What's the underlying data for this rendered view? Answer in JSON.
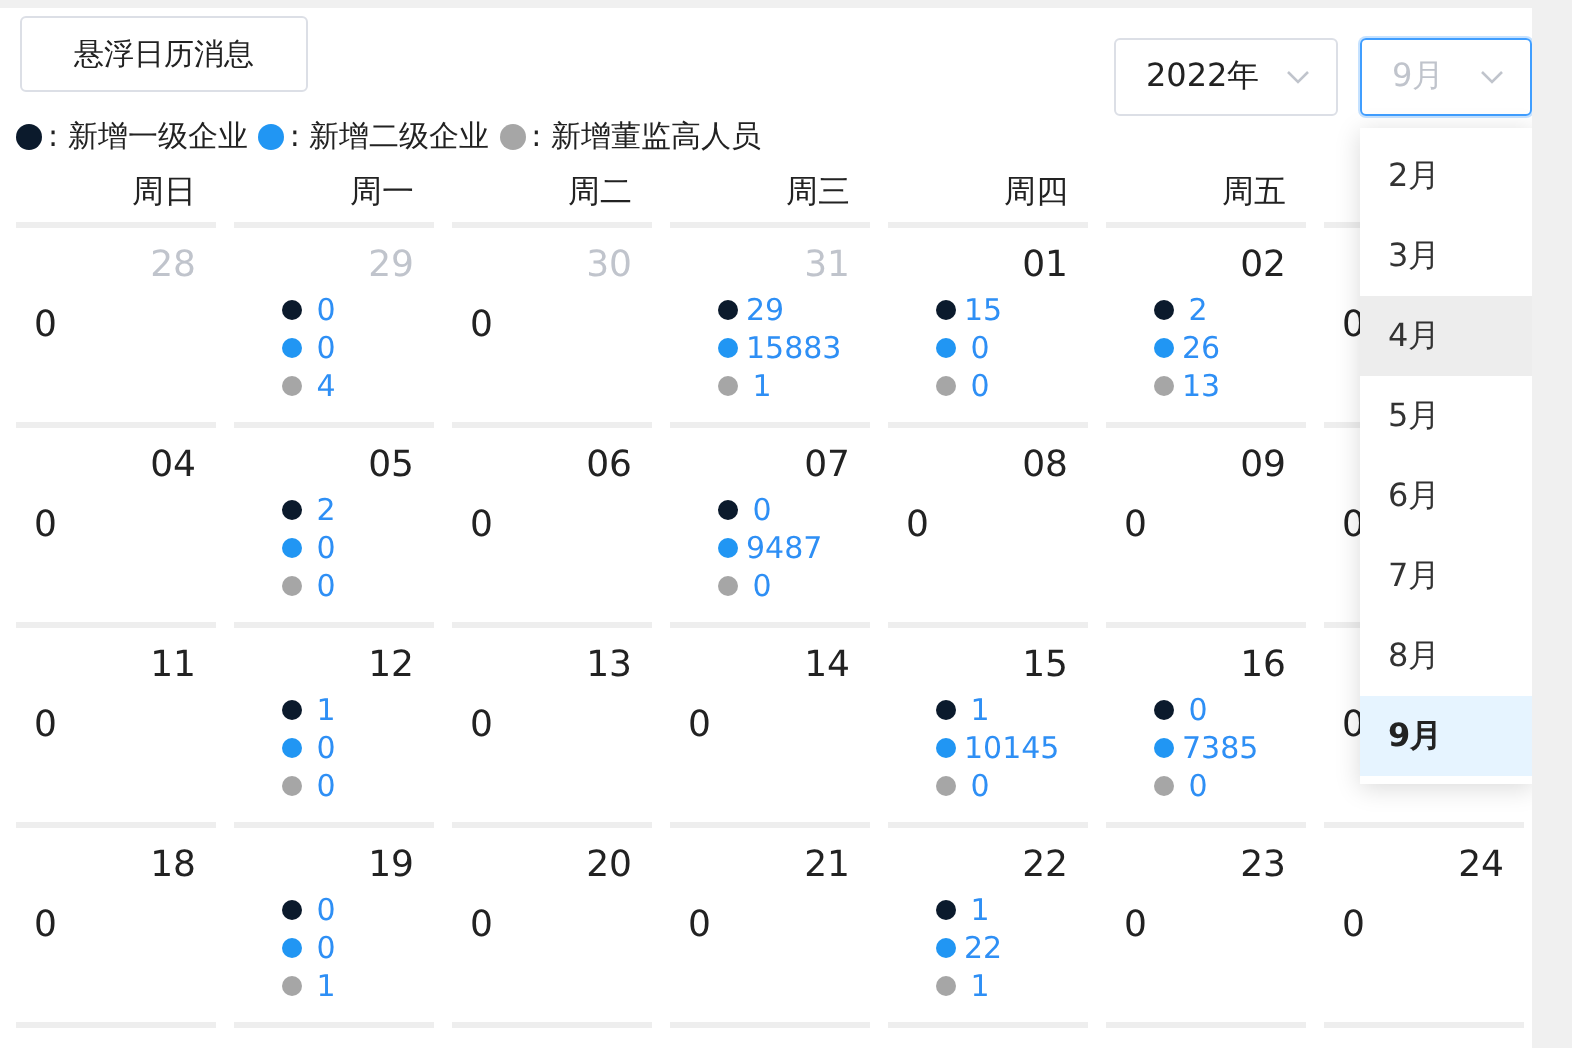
{
  "hover_button": {
    "label": "悬浮日历消息"
  },
  "year_select": {
    "value": "2022年"
  },
  "month_select": {
    "placeholder": "9月",
    "open": true
  },
  "month_options": [
    {
      "label": "2月",
      "selected": false,
      "hovered": false
    },
    {
      "label": "3月",
      "selected": false,
      "hovered": false
    },
    {
      "label": "4月",
      "selected": false,
      "hovered": true
    },
    {
      "label": "5月",
      "selected": false,
      "hovered": false
    },
    {
      "label": "6月",
      "selected": false,
      "hovered": false
    },
    {
      "label": "7月",
      "selected": false,
      "hovered": false
    },
    {
      "label": "8月",
      "selected": false,
      "hovered": false
    },
    {
      "label": "9月",
      "selected": true,
      "hovered": false
    }
  ],
  "legend": [
    {
      "separator": ":",
      "label": "新增一级企业",
      "color": "#0b1a2c"
    },
    {
      "separator": ":",
      "label": "新增二级企业",
      "color": "#2196f3"
    },
    {
      "separator": ":",
      "label": "新增董监高人员",
      "color": "#a6a6a6"
    }
  ],
  "weekdays": [
    "周日",
    "周一",
    "周二",
    "周三",
    "周四",
    "周五"
  ],
  "weeks": [
    {
      "days": [
        {
          "date": "28",
          "other_month": true,
          "kind": "zero",
          "value": "0"
        },
        {
          "date": "29",
          "other_month": true,
          "kind": "stats",
          "values": [
            "0",
            "0",
            "4"
          ]
        },
        {
          "date": "30",
          "other_month": true,
          "kind": "zero",
          "value": "0"
        },
        {
          "date": "31",
          "other_month": true,
          "kind": "stats",
          "values": [
            "29",
            "15883",
            "1"
          ]
        },
        {
          "date": "01",
          "other_month": false,
          "kind": "stats",
          "values": [
            "15",
            "0",
            "0"
          ]
        },
        {
          "date": "02",
          "other_month": false,
          "kind": "stats",
          "values": [
            "2",
            "26",
            "13"
          ]
        },
        {
          "kind": "zero",
          "value": "0"
        }
      ]
    },
    {
      "days": [
        {
          "date": "04",
          "other_month": false,
          "kind": "zero",
          "value": "0"
        },
        {
          "date": "05",
          "other_month": false,
          "kind": "stats",
          "values": [
            "2",
            "0",
            "0"
          ]
        },
        {
          "date": "06",
          "other_month": false,
          "kind": "zero",
          "value": "0"
        },
        {
          "date": "07",
          "other_month": false,
          "kind": "stats",
          "values": [
            "0",
            "9487",
            "0"
          ]
        },
        {
          "date": "08",
          "other_month": false,
          "kind": "zero",
          "value": "0"
        },
        {
          "date": "09",
          "other_month": false,
          "kind": "zero",
          "value": "0"
        },
        {
          "kind": "zero",
          "value": "0"
        }
      ]
    },
    {
      "days": [
        {
          "date": "11",
          "other_month": false,
          "kind": "zero",
          "value": "0"
        },
        {
          "date": "12",
          "other_month": false,
          "kind": "stats",
          "values": [
            "1",
            "0",
            "0"
          ]
        },
        {
          "date": "13",
          "other_month": false,
          "kind": "zero",
          "value": "0"
        },
        {
          "date": "14",
          "other_month": false,
          "kind": "zero",
          "value": "0"
        },
        {
          "date": "15",
          "other_month": false,
          "kind": "stats",
          "values": [
            "1",
            "10145",
            "0"
          ]
        },
        {
          "date": "16",
          "other_month": false,
          "kind": "stats",
          "values": [
            "0",
            "7385",
            "0"
          ]
        },
        {
          "kind": "zero",
          "value": "0"
        }
      ]
    },
    {
      "days": [
        {
          "date": "18",
          "other_month": false,
          "kind": "zero",
          "value": "0"
        },
        {
          "date": "19",
          "other_month": false,
          "kind": "stats",
          "values": [
            "0",
            "0",
            "1"
          ]
        },
        {
          "date": "20",
          "other_month": false,
          "kind": "zero",
          "value": "0"
        },
        {
          "date": "21",
          "other_month": false,
          "kind": "zero",
          "value": "0"
        },
        {
          "date": "22",
          "other_month": false,
          "kind": "stats",
          "values": [
            "1",
            "22",
            "1"
          ]
        },
        {
          "date": "23",
          "other_month": false,
          "kind": "zero",
          "value": "0"
        },
        {
          "date": "24",
          "other_month": false,
          "kind": "zero",
          "value": "0"
        }
      ]
    }
  ]
}
